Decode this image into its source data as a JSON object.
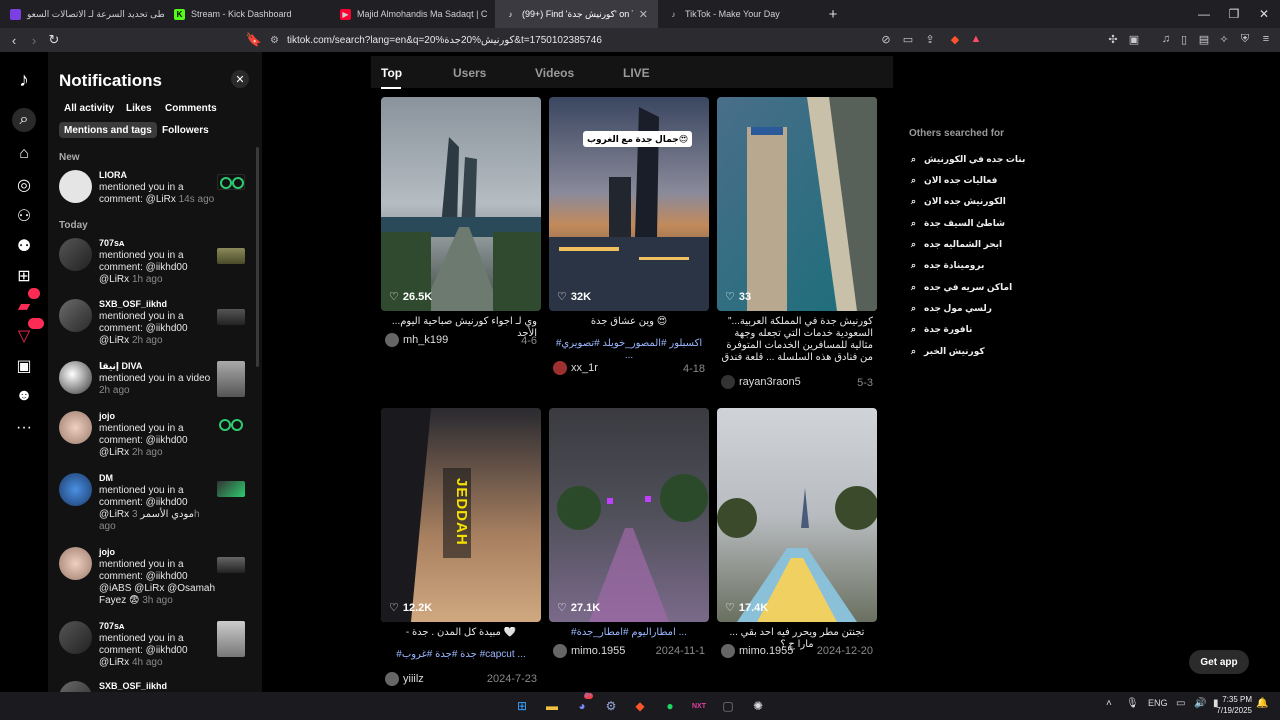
{
  "browser": {
    "tabs": [
      {
        "label": "تخطى تحديد السرعة لـ الاتصالات السعو",
        "icon": "purple-favicon-icon",
        "color": "#7b3fe4"
      },
      {
        "label": "Stream - Kick Dashboard",
        "icon": "kick-icon",
        "color": "#53fc18"
      },
      {
        "label": "Majid Almohandis Ma Sadaqt | C",
        "icon": "youtube-icon",
        "color": "#ff0033"
      },
      {
        "label": "(99+) Find 'كورنيش جدة' on TikTo",
        "icon": "tiktok-icon",
        "color": "#ffffff"
      },
      {
        "label": "TikTok - Make Your Day",
        "icon": "tiktok-icon",
        "color": "#ffffff"
      }
    ],
    "url": "tiktok.com/search?lang=en&q=كورنيش%20جدة%20&t=1750102385746"
  },
  "notifications": {
    "title": "Notifications",
    "filters": [
      "All activity",
      "Likes",
      "Comments",
      "Mentions and tags",
      "Followers"
    ],
    "selected_filter": "Mentions and tags",
    "section_new": "New",
    "section_today": "Today",
    "items": [
      {
        "name": "LIORA",
        "text": "mentioned you in a comment: @LiRx",
        "time": "14s ago"
      },
      {
        "name": "707ѕᴀ",
        "text": "mentioned you in a comment: @iikhd00 @LiRx",
        "time": "1h ago"
      },
      {
        "name": "SXB_OSF_iikhd",
        "text": "mentioned you in a comment: @iikhd00 @LiRx",
        "time": "2h ago"
      },
      {
        "name": "إنيقا DIVA",
        "text": "mentioned you in a video",
        "time": "2h ago"
      },
      {
        "name": "jojo",
        "text": "mentioned you in a comment: @iikhd00 @LiRx",
        "time": "2h ago"
      },
      {
        "name": "DM",
        "text": "mentioned you in a comment: @iikhd00 @LiRx مودي الأسمر",
        "time": "3h ago"
      },
      {
        "name": "jojo",
        "text": "mentioned you in a comment: @iikhd00 @iABS @LiRx @Osamah Fayez 😨",
        "time": "3h ago"
      },
      {
        "name": "707ѕᴀ",
        "text": "mentioned you in a comment: @iikhd00 @LiRx",
        "time": "4h ago"
      },
      {
        "name": "SXB_OSF_iikhd",
        "text": "",
        "time": ""
      }
    ]
  },
  "rail": {
    "badge_messages": "5",
    "badge_activity": "99+"
  },
  "search": {
    "tabs": [
      "Top",
      "Users",
      "Videos",
      "LIVE"
    ],
    "active_tab": "Top",
    "results": [
      {
        "likes": "26.5K",
        "desc": "...وي لـ اجواء كورنيش صباحية اليوم الأحد",
        "user": "mh_k199",
        "date": "4-6"
      },
      {
        "likes": "32K",
        "desc": "وين عشاق جدة 😍",
        "tags": "#اكسبلور #المصور_خويلد #تصويري ...",
        "user": "xx_1r",
        "date": "4-18",
        "overlay": "جمال جدة مع الغروب😍"
      },
      {
        "likes": "33",
        "desc": "\"...كورنيش جدة في المملكة العربية السعودية خدمات التي تجعله وجهة مثالية للمسافرين الخدمات المتوفرة من فنادق هذه السلسلة ... قلعة فندق داماك جدة الموجود في مدينة جدة",
        "user": "rayan3raon5",
        "date": "5-3"
      },
      {
        "likes": "12.2K",
        "desc": "- مبيدة كل المدن . جدة 🤍",
        "tags": "#جدة #جدة #غروب #capcut ...",
        "user": "yiiilz",
        "date": "2024-7-23",
        "overlay": "JEDDAH"
      },
      {
        "likes": "27.1K",
        "desc": "",
        "tags": "#امطاراليوم #امطار_جدة ...",
        "user": "mimo.1955",
        "date": "2024-11-1"
      },
      {
        "likes": "17.4K",
        "desc": "... تجنتن مطر ويحرر فيه احد بقي مارا ح ؟",
        "user": "mimo.1955",
        "date": "2024-12-20"
      }
    ]
  },
  "others": {
    "title": "Others searched for",
    "items": [
      "بنات جده في الكورنيش",
      "فعاليات جده الان",
      "الكورنيش جده الان",
      "شاطئ السيف جدة",
      "ابحر الشماليه جده",
      "برومينادة جده",
      "اماكن سريه في جده",
      "رلسي مول جده",
      "نافورة جدة",
      "كورنيش الخبر"
    ]
  },
  "get_app": "Get app",
  "taskbar": {
    "lang": "ENG",
    "time": "7:35 PM",
    "date": "7/19/2025",
    "discord_badge": "9+"
  }
}
